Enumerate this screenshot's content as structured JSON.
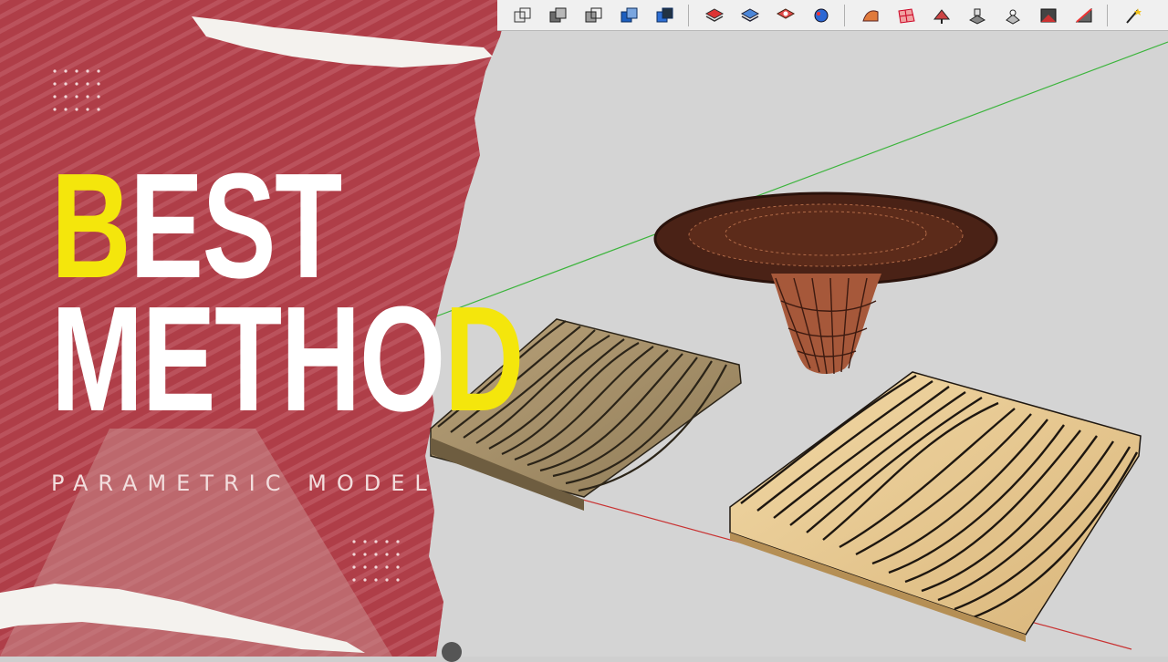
{
  "headline": {
    "line1_accent": "B",
    "line1_rest": "EST",
    "line2_rest": "METHO",
    "line2_accent": "D",
    "subtitle": "PARAMETRIC MODEL"
  },
  "colors": {
    "accent": "#f4e60c",
    "panel_red": "#b4424c",
    "viewport_bg": "#d4d4d4",
    "axis_green": "#3cb43c",
    "axis_red": "#c83232"
  },
  "toolbar": {
    "groups": [
      [
        "section-plane-icon",
        "section-cut-icon",
        "section-fill-icon",
        "display-section-icon",
        "section-cut-blue-icon"
      ],
      [
        "layers-stack-icon",
        "layers-blue-icon",
        "layers-red-icon",
        "paint-ball-icon"
      ],
      [
        "sandbox-from-contours-icon",
        "sandbox-from-scratch-icon",
        "smoove-icon",
        "stamp-icon",
        "drape-icon",
        "add-detail-icon",
        "flip-edge-icon"
      ],
      [
        "magic-wand-icon"
      ]
    ]
  }
}
